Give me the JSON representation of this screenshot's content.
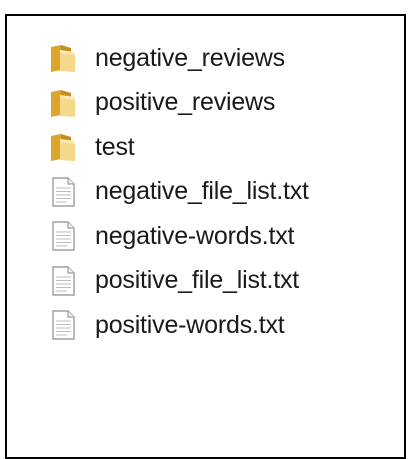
{
  "explorer": {
    "items": [
      {
        "type": "folder",
        "icon": "folder-icon",
        "name": "negative_reviews"
      },
      {
        "type": "folder",
        "icon": "folder-icon",
        "name": "positive_reviews"
      },
      {
        "type": "folder",
        "icon": "folder-icon",
        "name": "test"
      },
      {
        "type": "file",
        "icon": "text-file-icon",
        "name": "negative_file_list.txt"
      },
      {
        "type": "file",
        "icon": "text-file-icon",
        "name": "negative-words.txt"
      },
      {
        "type": "file",
        "icon": "text-file-icon",
        "name": "positive_file_list.txt"
      },
      {
        "type": "file",
        "icon": "text-file-icon",
        "name": "positive-words.txt"
      }
    ]
  },
  "colors": {
    "folder_light": "#f6d88a",
    "folder_dark": "#d9a52c",
    "file_outline": "#9aa0a8",
    "file_lines": "#b8bec6"
  }
}
